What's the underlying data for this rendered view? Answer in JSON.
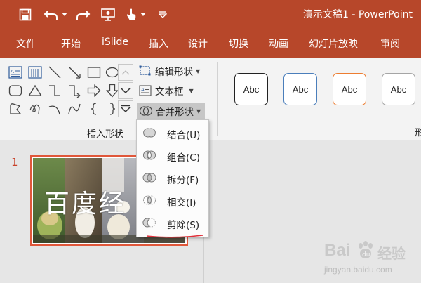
{
  "app": {
    "window_title": "演示文稿1  -  PowerPoint"
  },
  "quick_access": {
    "icons": [
      "save-icon",
      "undo-icon",
      "dropdown-caret-icon",
      "redo-icon",
      "presentation-icon",
      "touch-mode-icon",
      "dropdown-caret-icon",
      "customize-icon"
    ]
  },
  "tabs": [
    "文件",
    "开始",
    "iSlide",
    "插入",
    "设计",
    "切换",
    "动画",
    "幻灯片放映",
    "审阅"
  ],
  "ribbon": {
    "edit_shape": "编辑形状",
    "text_box": "文本框",
    "merge_shapes": "合并形状",
    "group_label": "插入形状",
    "style_cards": [
      {
        "label": "Abc",
        "border": "#222222"
      },
      {
        "label": "Abc",
        "border": "#4a7ebb"
      },
      {
        "label": "Abc",
        "border": "#ed7d31"
      },
      {
        "label": "Abc",
        "border": "#a5a5a5"
      }
    ],
    "cut_label": "形"
  },
  "merge_menu": {
    "items": [
      {
        "label": "结合(U)",
        "icon": "union-icon"
      },
      {
        "label": "组合(C)",
        "icon": "combine-icon"
      },
      {
        "label": "拆分(F)",
        "icon": "fragment-icon"
      },
      {
        "label": "相交(I)",
        "icon": "intersect-icon"
      },
      {
        "label": "剪除(S)",
        "icon": "subtract-icon"
      }
    ]
  },
  "slides": {
    "number": "1",
    "title": "百度经"
  },
  "watermark": {
    "brand": "Bai",
    "brand_cn": "经验",
    "url": "jingyan.baidu.com"
  },
  "colors": {
    "title_bar": "#b7472a",
    "ribbon_bg": "#f3f3f3",
    "workspace_bg": "#e6e6e6",
    "slide_selection": "#e0573a",
    "annotation_underline": "#e0303a"
  }
}
